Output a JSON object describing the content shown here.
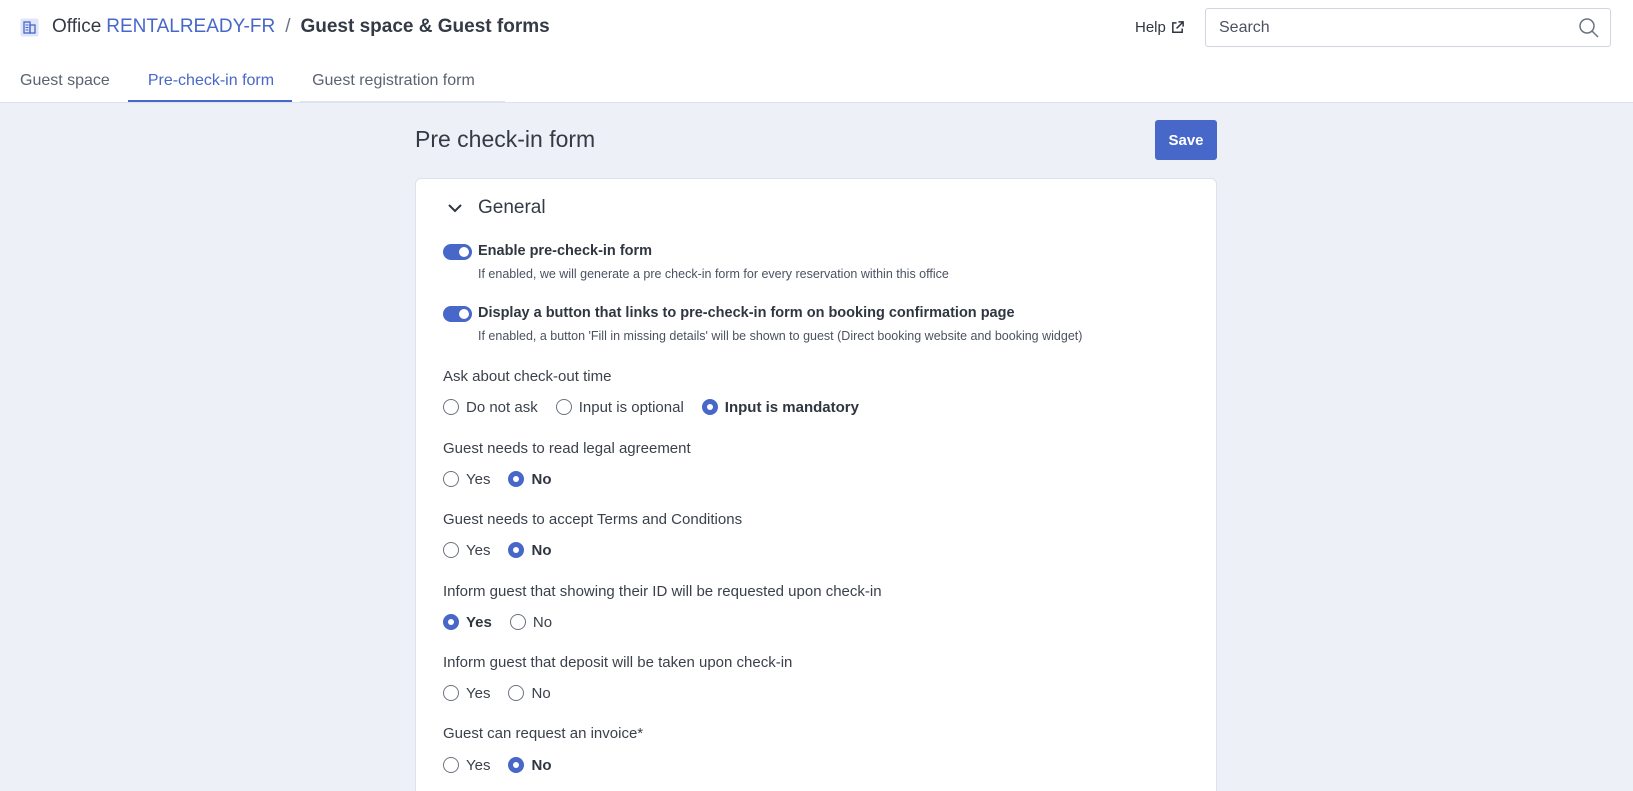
{
  "header": {
    "breadcrumb_prefix": "Office",
    "office_name": "RENTALREADY-FR",
    "separator": "/",
    "page": "Guest space & Guest forms",
    "help_label": "Help",
    "search_placeholder": "Search"
  },
  "tabs": [
    {
      "label": "Guest space",
      "active": false
    },
    {
      "label": "Pre-check-in form",
      "active": true
    },
    {
      "label": "Guest registration form",
      "active": false
    }
  ],
  "content": {
    "title": "Pre check-in form",
    "save_label": "Save",
    "section_title": "General",
    "toggles": [
      {
        "label": "Enable pre-check-in form",
        "help": "If enabled, we will generate a pre check-in form for every reservation within this office",
        "enabled": true
      },
      {
        "label": "Display a button that links to pre-check-in form on booking confirmation page",
        "help": "If enabled, a button 'Fill in missing details' will be shown to guest (Direct booking website and booking widget)",
        "enabled": true
      }
    ],
    "questions": [
      {
        "label": "Ask about check-out time",
        "options": [
          "Do not ask",
          "Input is optional",
          "Input is mandatory"
        ],
        "selected": "Input is mandatory"
      },
      {
        "label": "Guest needs to read legal agreement",
        "options": [
          "Yes",
          "No"
        ],
        "selected": "No"
      },
      {
        "label": "Guest needs to accept Terms and Conditions",
        "options": [
          "Yes",
          "No"
        ],
        "selected": "No"
      },
      {
        "label": "Inform guest that showing their ID will be requested upon check-in",
        "options": [
          "Yes",
          "No"
        ],
        "selected": "Yes"
      },
      {
        "label": "Inform guest that deposit will be taken upon check-in",
        "options": [
          "Yes",
          "No"
        ],
        "selected": ""
      },
      {
        "label": "Guest can request an invoice*",
        "options": [
          "Yes",
          "No"
        ],
        "selected": "No"
      }
    ]
  },
  "colors": {
    "accent": "#4767c9",
    "background": "#edf0f7"
  }
}
